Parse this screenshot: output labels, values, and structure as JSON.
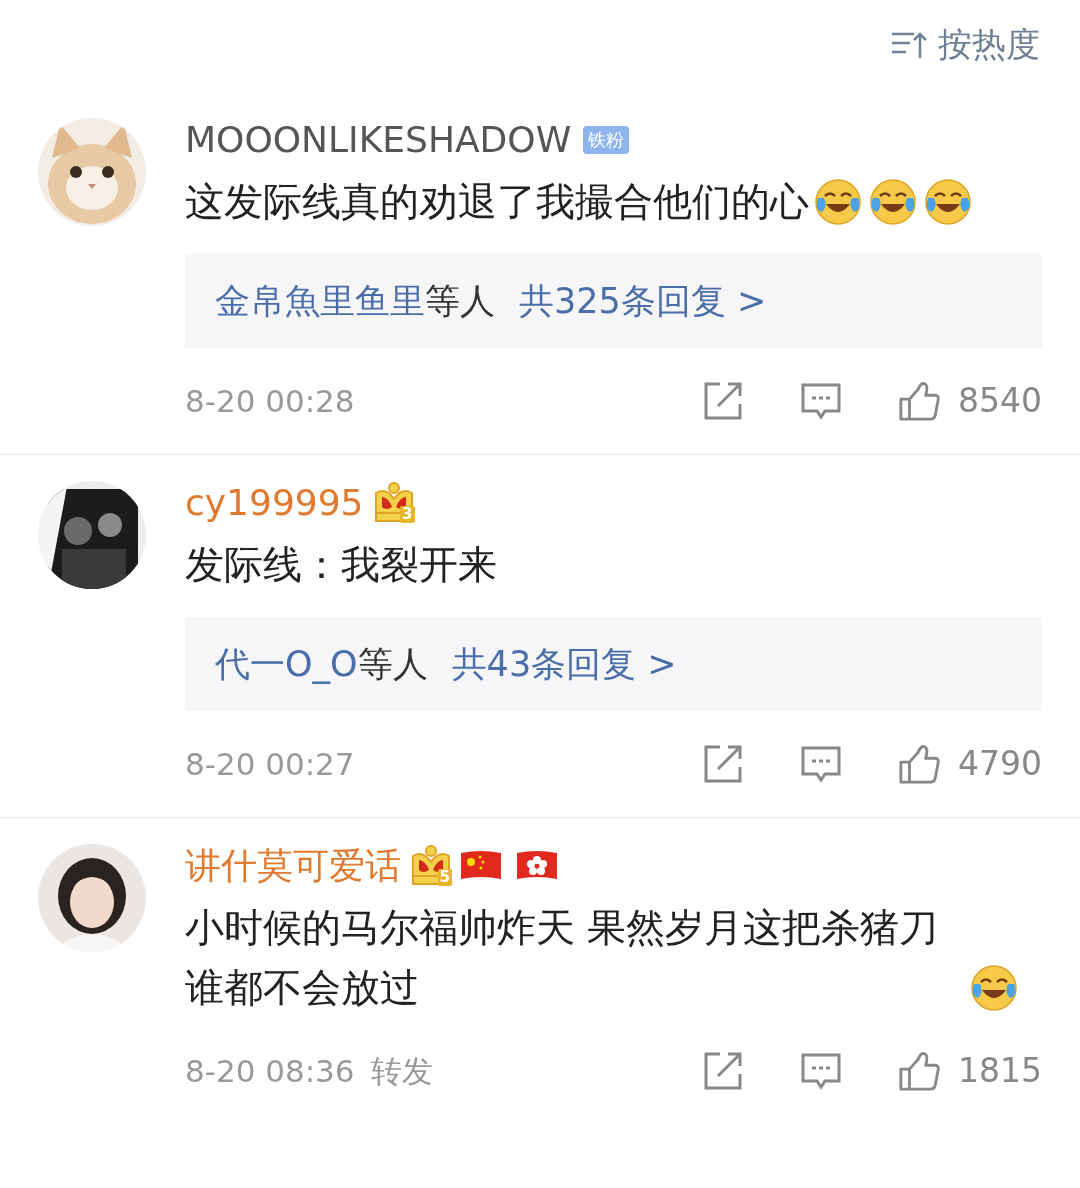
{
  "sort": {
    "label": "按热度"
  },
  "comments": [
    {
      "username": "MOOONLIKESHADOW",
      "vip": false,
      "badges": [
        {
          "kind": "fan",
          "label": "铁粉"
        }
      ],
      "text": "这发际线真的劝退了我撮合他们的心",
      "emojis": [
        {
          "kind": "laugh"
        },
        {
          "kind": "laugh"
        },
        {
          "kind": "laugh"
        }
      ],
      "replies": {
        "users": "金帛魚里鱼里",
        "suffix": "等人",
        "count": "共325条回复 >"
      },
      "time": "8-20 00:28",
      "likes": "8540"
    },
    {
      "username": "cy199995",
      "vip": true,
      "badges": [
        {
          "kind": "crown",
          "label": "3"
        }
      ],
      "text": "发际线：我裂开来",
      "replies": {
        "users": "代一O_O",
        "suffix": "等人",
        "count": "共43条回复 >"
      },
      "time": "8-20 00:27",
      "likes": "4790"
    },
    {
      "username": "讲什莫可爱话",
      "vip": true,
      "badges": [
        {
          "kind": "crown",
          "label": "5"
        },
        {
          "kind": "flag-cn"
        },
        {
          "kind": "flag-hk"
        }
      ],
      "text": "小时候的马尔福帅炸天 果然岁月这把杀猪刀谁都不会放过",
      "emojis": [
        {
          "kind": "laugh"
        }
      ],
      "time": "8-20 08:36",
      "forward": "转发",
      "likes": "1815"
    }
  ]
}
